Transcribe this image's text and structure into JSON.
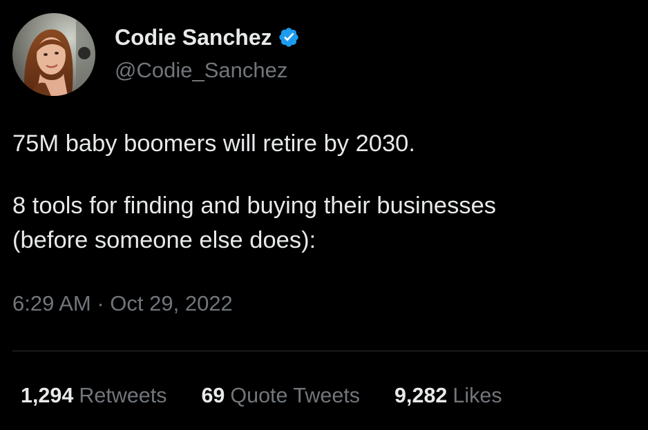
{
  "author": {
    "display_name": "Codie Sanchez",
    "handle": "@Codie_Sanchez",
    "verified": true,
    "avatar_icon": "user-avatar-photo"
  },
  "tweet": {
    "paragraphs": [
      "75M baby boomers will retire by 2030.",
      "8 tools for finding and buying their businesses",
      "(before someone else does):"
    ],
    "timestamp": "6:29 AM · Oct 29, 2022"
  },
  "stats": {
    "retweets_count": "1,294",
    "retweets_label": "Retweets",
    "quote_tweets_count": "69",
    "quote_tweets_label": "Quote Tweets",
    "likes_count": "9,282",
    "likes_label": "Likes"
  },
  "colors": {
    "background": "#000000",
    "primary_text": "#e7e9ea",
    "secondary_text": "#71767b",
    "verified_blue": "#1d9bf0",
    "divider": "#2f3336"
  },
  "icons": {
    "verified": "verified-badge-icon"
  }
}
